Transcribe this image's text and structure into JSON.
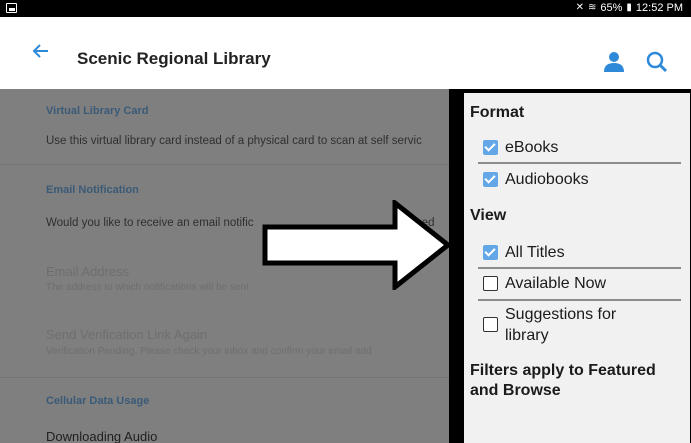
{
  "status_bar": {
    "battery": "65%",
    "time": "12:52 PM"
  },
  "app_bar": {
    "title": "Scenic Regional Library"
  },
  "settings": {
    "virtual_card_header": "Virtual Library Card",
    "virtual_card_text": "Use this virtual library card instead of a physical card to scan at self servic",
    "email_notification_header": "Email Notification",
    "email_notification_text": "Would you like to receive an email notific",
    "email_notification_tail": "ced",
    "email_address_label": "Email Address",
    "email_address_sub": "The address to which notifications will be sent",
    "send_verification_label": "Send Verification Link Again",
    "send_verification_sub": "Verification Pending. Please check your inbox and confirm your email add",
    "cellular_header": "Cellular Data Usage",
    "downloading_audio": "Downloading Audio"
  },
  "filter_panel": {
    "format_heading": "Format",
    "format_options": [
      {
        "label": "eBooks",
        "checked": true
      },
      {
        "label": "Audiobooks",
        "checked": true
      }
    ],
    "view_heading": "View",
    "view_options": [
      {
        "label": "All Titles",
        "checked": true
      },
      {
        "label": "Available Now",
        "checked": false
      },
      {
        "label": "Suggestions for",
        "label2": "library",
        "checked": false
      }
    ],
    "note": "Filters apply to Featured and Browse"
  },
  "colors": {
    "accent": "#2e8ad8",
    "checkbox": "#63a7e6"
  }
}
